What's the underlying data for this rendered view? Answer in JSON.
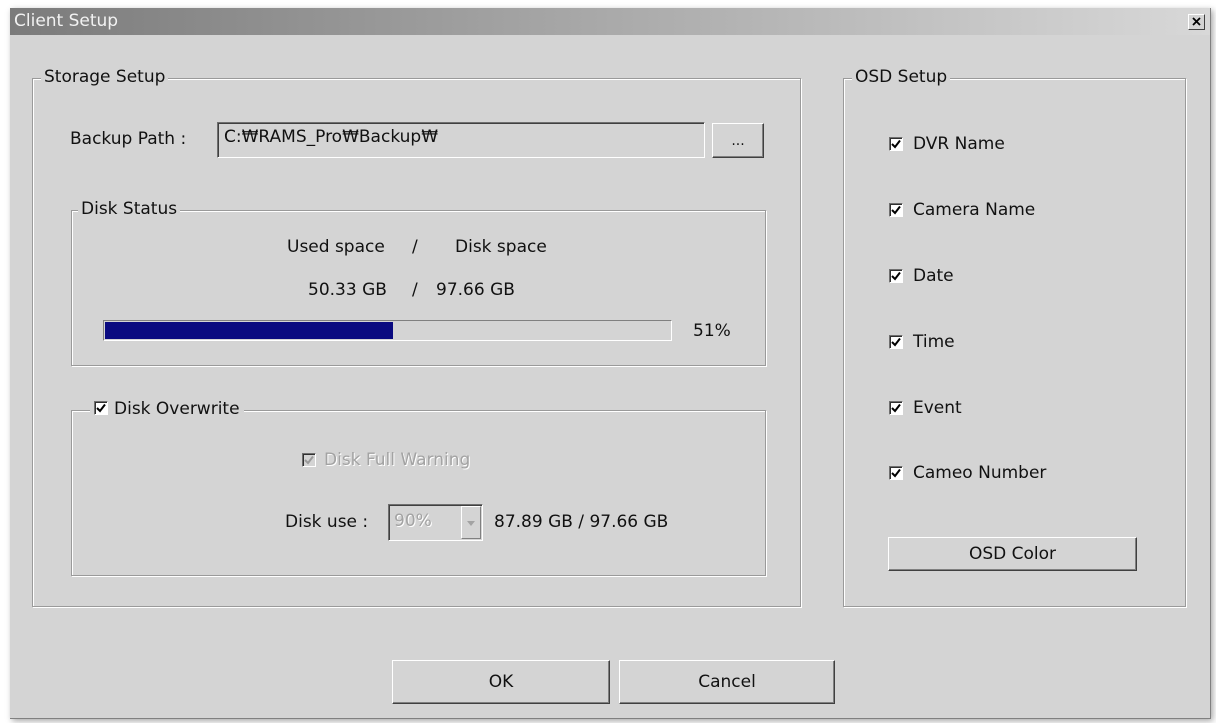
{
  "window": {
    "title": "Client Setup",
    "close_glyph": "✕"
  },
  "storage": {
    "legend": "Storage Setup",
    "backup_path_label": "Backup Path :",
    "backup_path_value": "C:₩RAMS_Pro₩Backup₩",
    "browse_label": "...",
    "disk_status": {
      "legend": "Disk Status",
      "header_used": "Used space",
      "header_sep": "/",
      "header_disk": "Disk space",
      "used_value": "50.33 GB",
      "value_sep": "/",
      "disk_value": "97.66 GB",
      "percent_label": "51%",
      "percent": 0.51
    },
    "disk_overwrite": {
      "label": "Disk Overwrite",
      "checked": true,
      "full_warning_label": "Disk Full Warning",
      "full_warning_checked": true,
      "disk_use_label": "Disk use :",
      "disk_use_value": "90%",
      "disk_use_detail": "87.89 GB / 97.66 GB"
    }
  },
  "osd": {
    "legend": "OSD Setup",
    "items": [
      {
        "label": "DVR Name",
        "checked": true
      },
      {
        "label": "Camera Name",
        "checked": true
      },
      {
        "label": "Date",
        "checked": true
      },
      {
        "label": "Time",
        "checked": true
      },
      {
        "label": "Event",
        "checked": true
      },
      {
        "label": "Cameo Number",
        "checked": true
      }
    ],
    "color_button": "OSD Color"
  },
  "footer": {
    "ok_label": "OK",
    "cancel_label": "Cancel"
  },
  "colors": {
    "progress_fill": "#0a0a80",
    "dialog_bg": "#d4d4d4"
  },
  "icons": {
    "check": "checkmark-icon",
    "dropdown": "chevron-down-icon"
  }
}
